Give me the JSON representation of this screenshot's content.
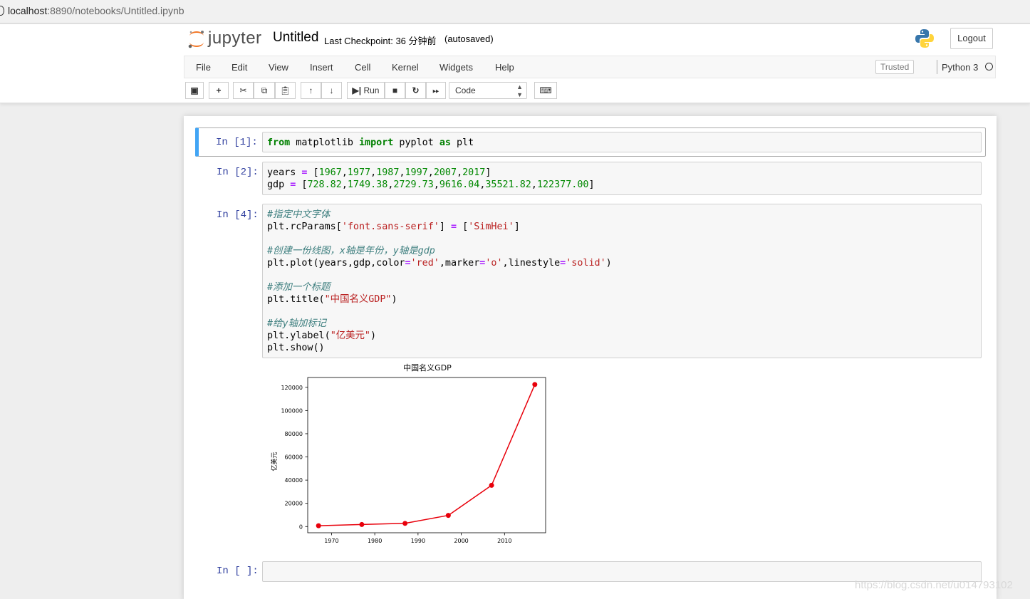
{
  "browser": {
    "url_host": "localhost",
    "url_rest": ":8890/notebooks/Untitled.ipynb"
  },
  "header": {
    "logo_text": "jupyter",
    "notebook_title": "Untitled",
    "checkpoint": "Last Checkpoint: 36 分钟前",
    "autosave_status": "(autosaved)",
    "logout_label": "Logout"
  },
  "menu": {
    "items": [
      "File",
      "Edit",
      "View",
      "Insert",
      "Cell",
      "Kernel",
      "Widgets",
      "Help"
    ],
    "trusted_label": "Trusted",
    "kernel_name": "Python 3"
  },
  "toolbar": {
    "run_label": "Run",
    "cell_type": "Code",
    "icons": [
      "save-icon",
      "plus-icon",
      "cut-icon",
      "copy-icon",
      "paste-icon",
      "arrow-up-icon",
      "arrow-down-icon",
      "step-run-icon",
      "stop-icon",
      "restart-icon",
      "fast-forward-icon",
      "keyboard-icon"
    ]
  },
  "cells": [
    {
      "prompt": "In [1]:",
      "lines": [
        "from matplotlib import pyplot as plt"
      ]
    },
    {
      "prompt": "In [2]:",
      "lines": [
        "years = [1967,1977,1987,1997,2007,2017]",
        "gdp = [728.82,1749.38,2729.73,9616.04,35521.82,122377.00]"
      ]
    },
    {
      "prompt": "In [4]:",
      "lines": [
        "#指定中文字体",
        "plt.rcParams['font.sans-serif'] = ['SimHei']",
        "",
        "#创建一份线图，x轴是年份，y轴是gdp",
        "plt.plot(years,gdp,color='red',marker='o',linestyle='solid')",
        "",
        "#添加一个标题",
        "plt.title(\"中国名义GDP\")",
        "",
        "#给y轴加标记",
        "plt.ylabel(\"亿美元\")",
        "plt.show()"
      ]
    },
    {
      "prompt": "In [ ]:",
      "lines": []
    }
  ],
  "chart_data": {
    "type": "line",
    "title": "中国名义GDP",
    "xlabel": "",
    "ylabel": "亿美元",
    "x": [
      1967,
      1977,
      1987,
      1997,
      2007,
      2017
    ],
    "series": [
      {
        "values": [
          728.82,
          1749.38,
          2729.73,
          9616.04,
          35521.82,
          122377.0
        ],
        "color": "#e8000b",
        "marker": "o"
      }
    ],
    "xticks": [
      1970,
      1980,
      1990,
      2000,
      2010
    ],
    "yticks": [
      0,
      20000,
      40000,
      60000,
      80000,
      100000,
      120000
    ],
    "xlim": [
      1964.5,
      2019.5
    ],
    "ylim": [
      -5353,
      128459
    ],
    "grid": false
  },
  "watermark": "https://blog.csdn.net/u014793102"
}
